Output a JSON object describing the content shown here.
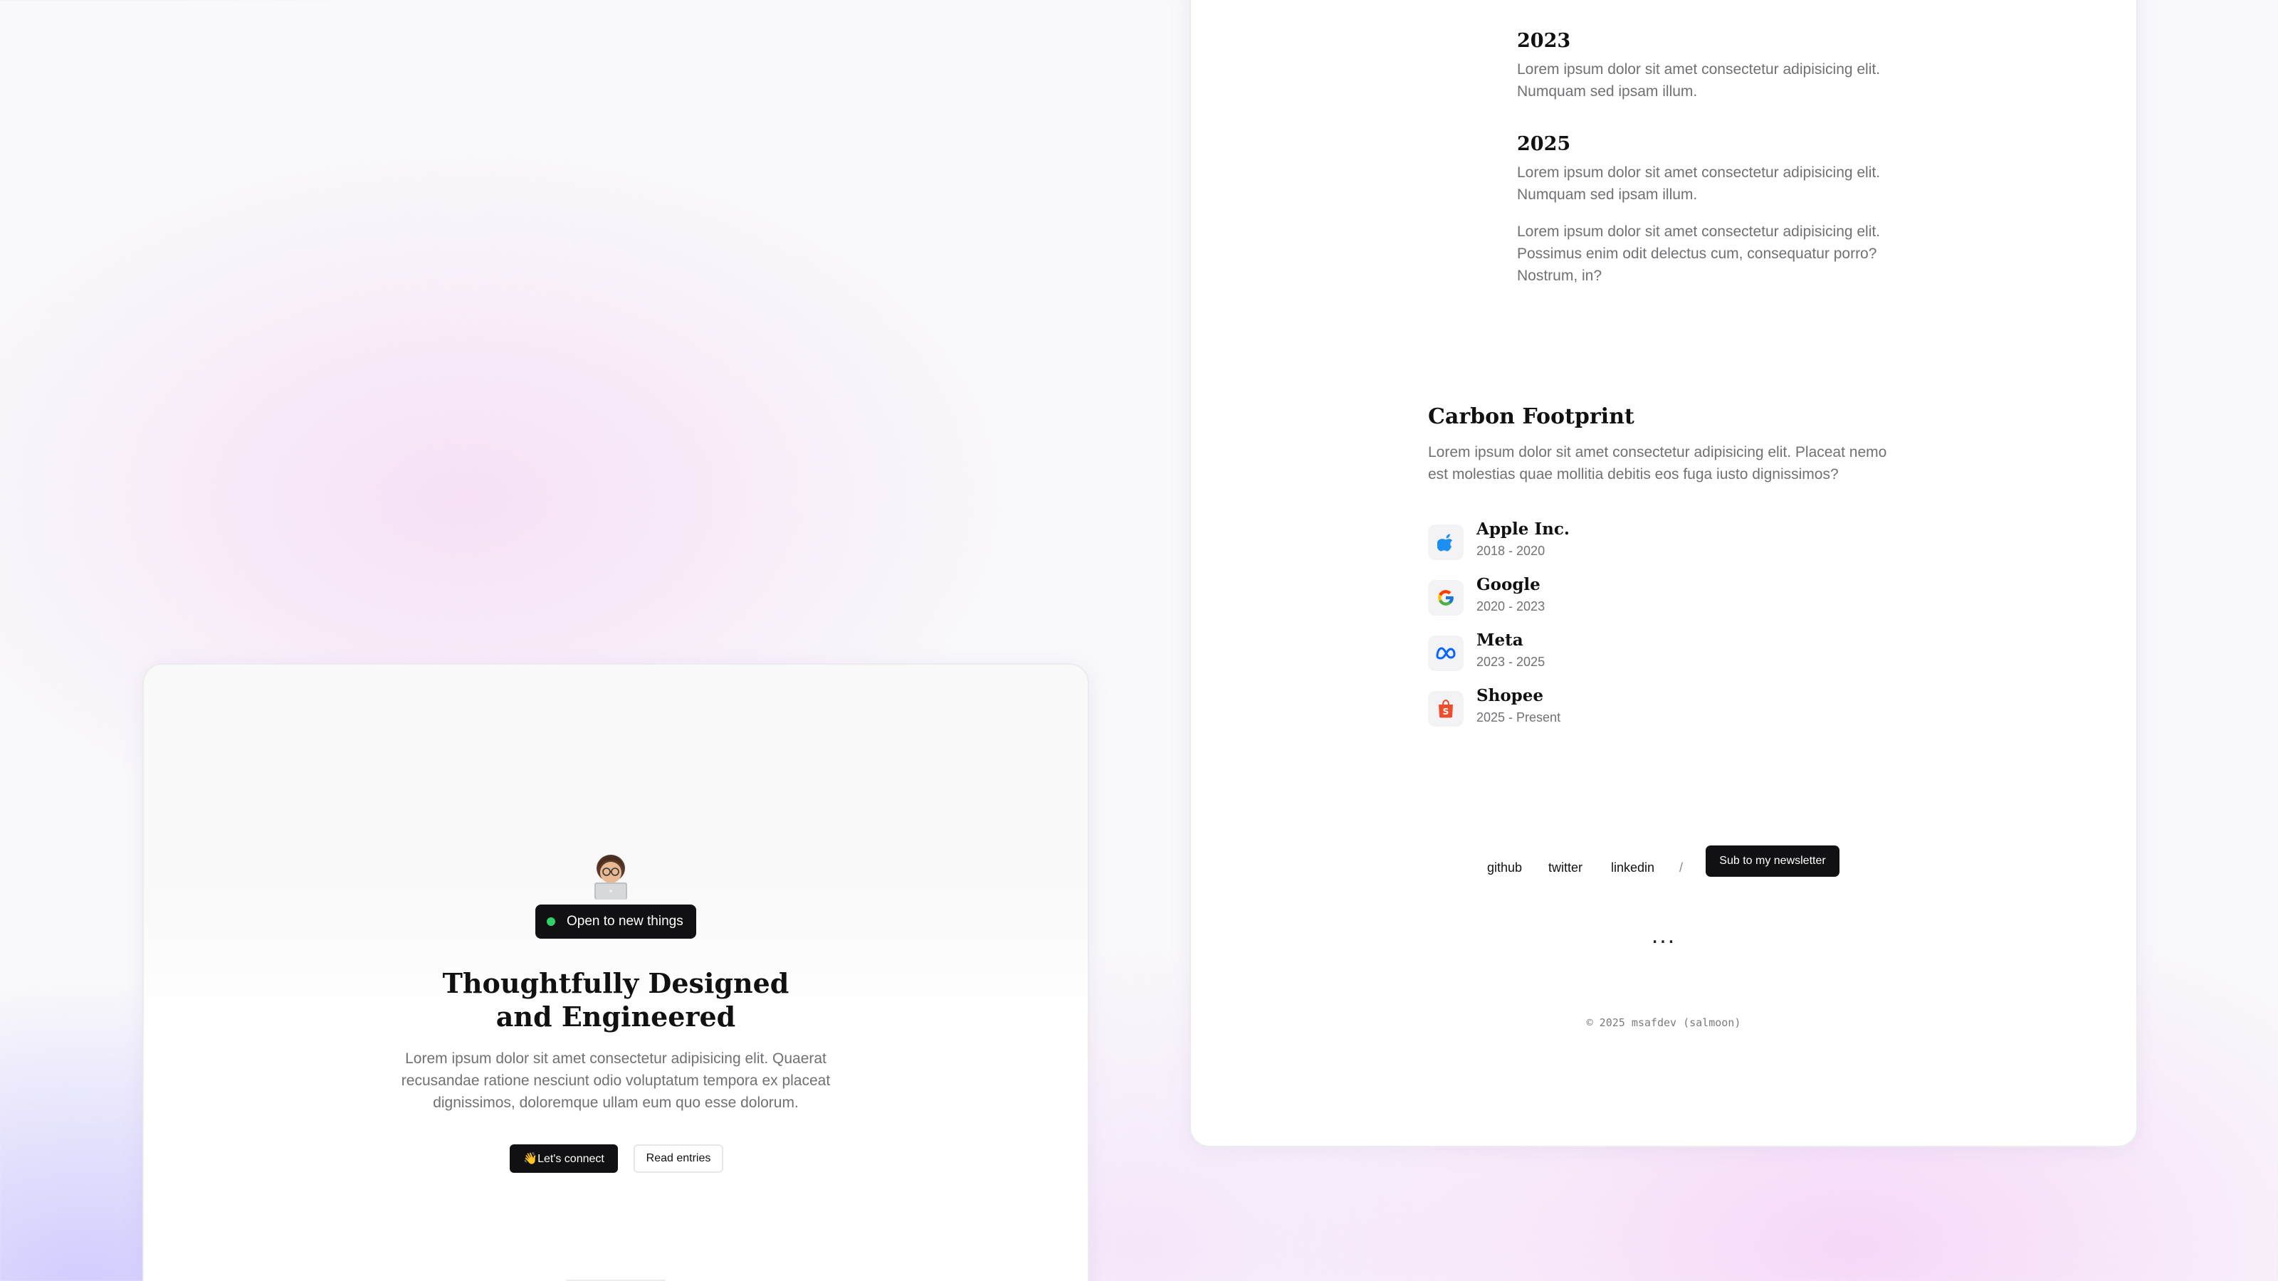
{
  "hero": {
    "status_label": "Open to new things",
    "title_line1": "Thoughtfully Designed",
    "title_line2": "and Engineered",
    "description": "Lorem ipsum dolor sit amet consectetur adipisicing elit. Quaerat recusandae ratione nesciunt odio voluptatum tempora ex placeat dignissimos, doloremque ullam eum quo esse dolorum.",
    "connect_label": "👋Let's connect",
    "read_label": "Read entries"
  },
  "timeline": [
    {
      "year": "2023",
      "paragraphs": [
        "Lorem ipsum dolor sit amet consectetur adipisicing elit. Numquam sed ipsam illum."
      ]
    },
    {
      "year": "2025",
      "paragraphs": [
        "Lorem ipsum dolor sit amet consectetur adipisicing elit. Numquam sed ipsam illum.",
        "Lorem ipsum dolor sit amet consectetur adipisicing elit. Possimus enim odit delectus cum, consequatur porro? Nostrum, in?"
      ]
    }
  ],
  "carbon": {
    "title": "Carbon Footprint",
    "description": "Lorem ipsum dolor sit amet consectetur adipisicing elit. Placeat nemo est molestias quae mollitia debitis eos fuga iusto dignissimos?",
    "companies": [
      {
        "name": "Apple Inc.",
        "years": "2018 - 2020",
        "icon": "apple-icon"
      },
      {
        "name": "Google",
        "years": "2020 - 2023",
        "icon": "google-icon"
      },
      {
        "name": "Meta",
        "years": "2023 - 2025",
        "icon": "meta-icon"
      },
      {
        "name": "Shopee",
        "years": "2025 - Present",
        "icon": "shopee-icon"
      }
    ]
  },
  "footer": {
    "links": [
      "github",
      "twitter",
      "linkedin"
    ],
    "separator": "/",
    "newsletter_label": "Sub to my newsletter",
    "ellipsis": "...",
    "copyright": "© 2025 msafdev (salmoon)"
  },
  "colors": {
    "accent_dark": "#111113",
    "status_green": "#2fd266",
    "text_muted": "#707075"
  }
}
